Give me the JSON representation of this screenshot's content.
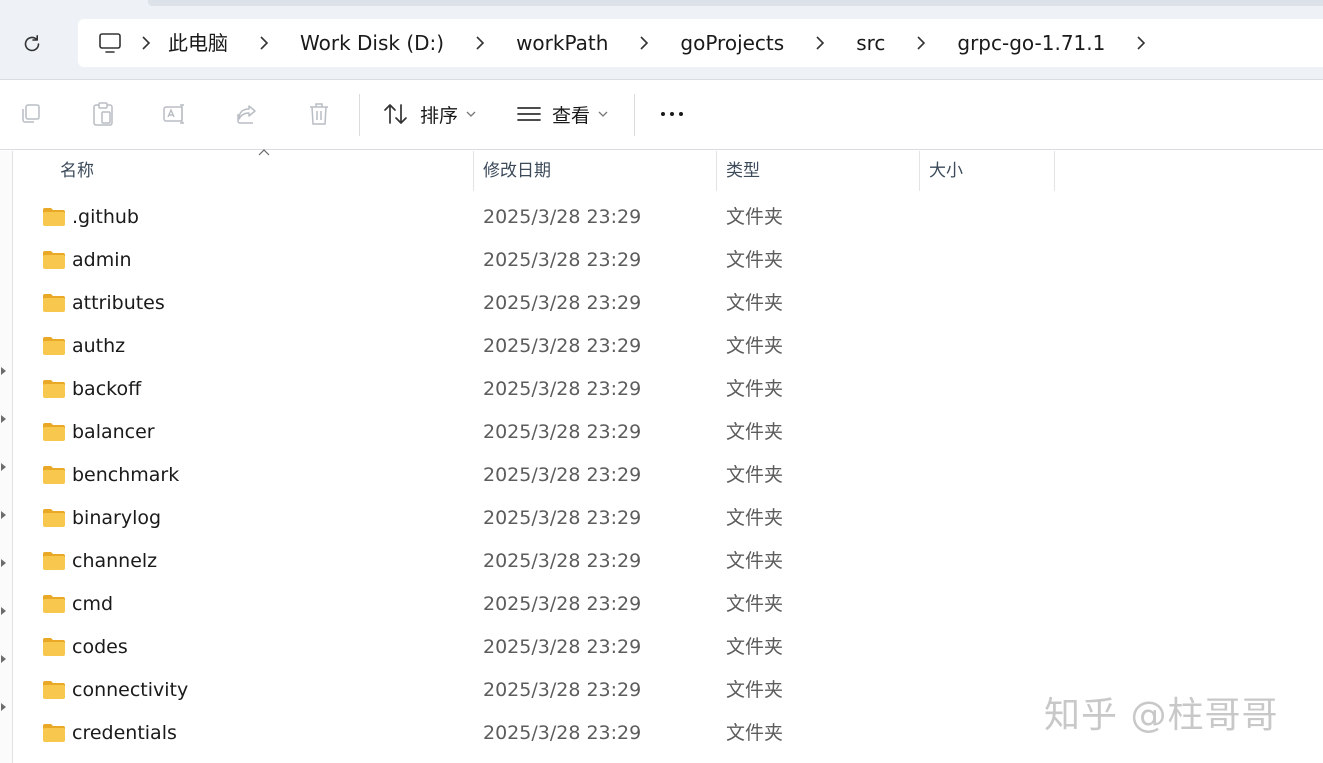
{
  "address_bar": {
    "breadcrumbs": [
      "此电脑",
      "Work Disk (D:)",
      "workPath",
      "goProjects",
      "src",
      "grpc-go-1.71.1"
    ]
  },
  "command_bar": {
    "sort_label": "排序",
    "view_label": "查看"
  },
  "columns": {
    "name": "名称",
    "modified": "修改日期",
    "type": "类型",
    "size": "大小"
  },
  "files": [
    {
      "name": ".github",
      "modified": "2025/3/28 23:29",
      "type": "文件夹"
    },
    {
      "name": "admin",
      "modified": "2025/3/28 23:29",
      "type": "文件夹"
    },
    {
      "name": "attributes",
      "modified": "2025/3/28 23:29",
      "type": "文件夹"
    },
    {
      "name": "authz",
      "modified": "2025/3/28 23:29",
      "type": "文件夹"
    },
    {
      "name": "backoff",
      "modified": "2025/3/28 23:29",
      "type": "文件夹"
    },
    {
      "name": "balancer",
      "modified": "2025/3/28 23:29",
      "type": "文件夹"
    },
    {
      "name": "benchmark",
      "modified": "2025/3/28 23:29",
      "type": "文件夹"
    },
    {
      "name": "binarylog",
      "modified": "2025/3/28 23:29",
      "type": "文件夹"
    },
    {
      "name": "channelz",
      "modified": "2025/3/28 23:29",
      "type": "文件夹"
    },
    {
      "name": "cmd",
      "modified": "2025/3/28 23:29",
      "type": "文件夹"
    },
    {
      "name": "codes",
      "modified": "2025/3/28 23:29",
      "type": "文件夹"
    },
    {
      "name": "connectivity",
      "modified": "2025/3/28 23:29",
      "type": "文件夹"
    },
    {
      "name": "credentials",
      "modified": "2025/3/28 23:29",
      "type": "文件夹"
    }
  ],
  "watermark": "知乎 @柱哥哥",
  "icons": {
    "refresh": "refresh-icon",
    "computer": "computer-icon",
    "copy": "copy-icon",
    "paste": "paste-icon",
    "rename": "rename-icon",
    "share": "share-icon",
    "delete": "delete-icon",
    "sort": "sort-icon",
    "view": "view-icon",
    "more": "more-icon",
    "folder": "folder-icon"
  },
  "colors": {
    "folder_fill": "#f8c74d",
    "folder_tab": "#e9a825",
    "header_text": "#3c4a5a",
    "secondary_text": "#5c5c5c",
    "disabled_icon": "#b9bec4"
  }
}
